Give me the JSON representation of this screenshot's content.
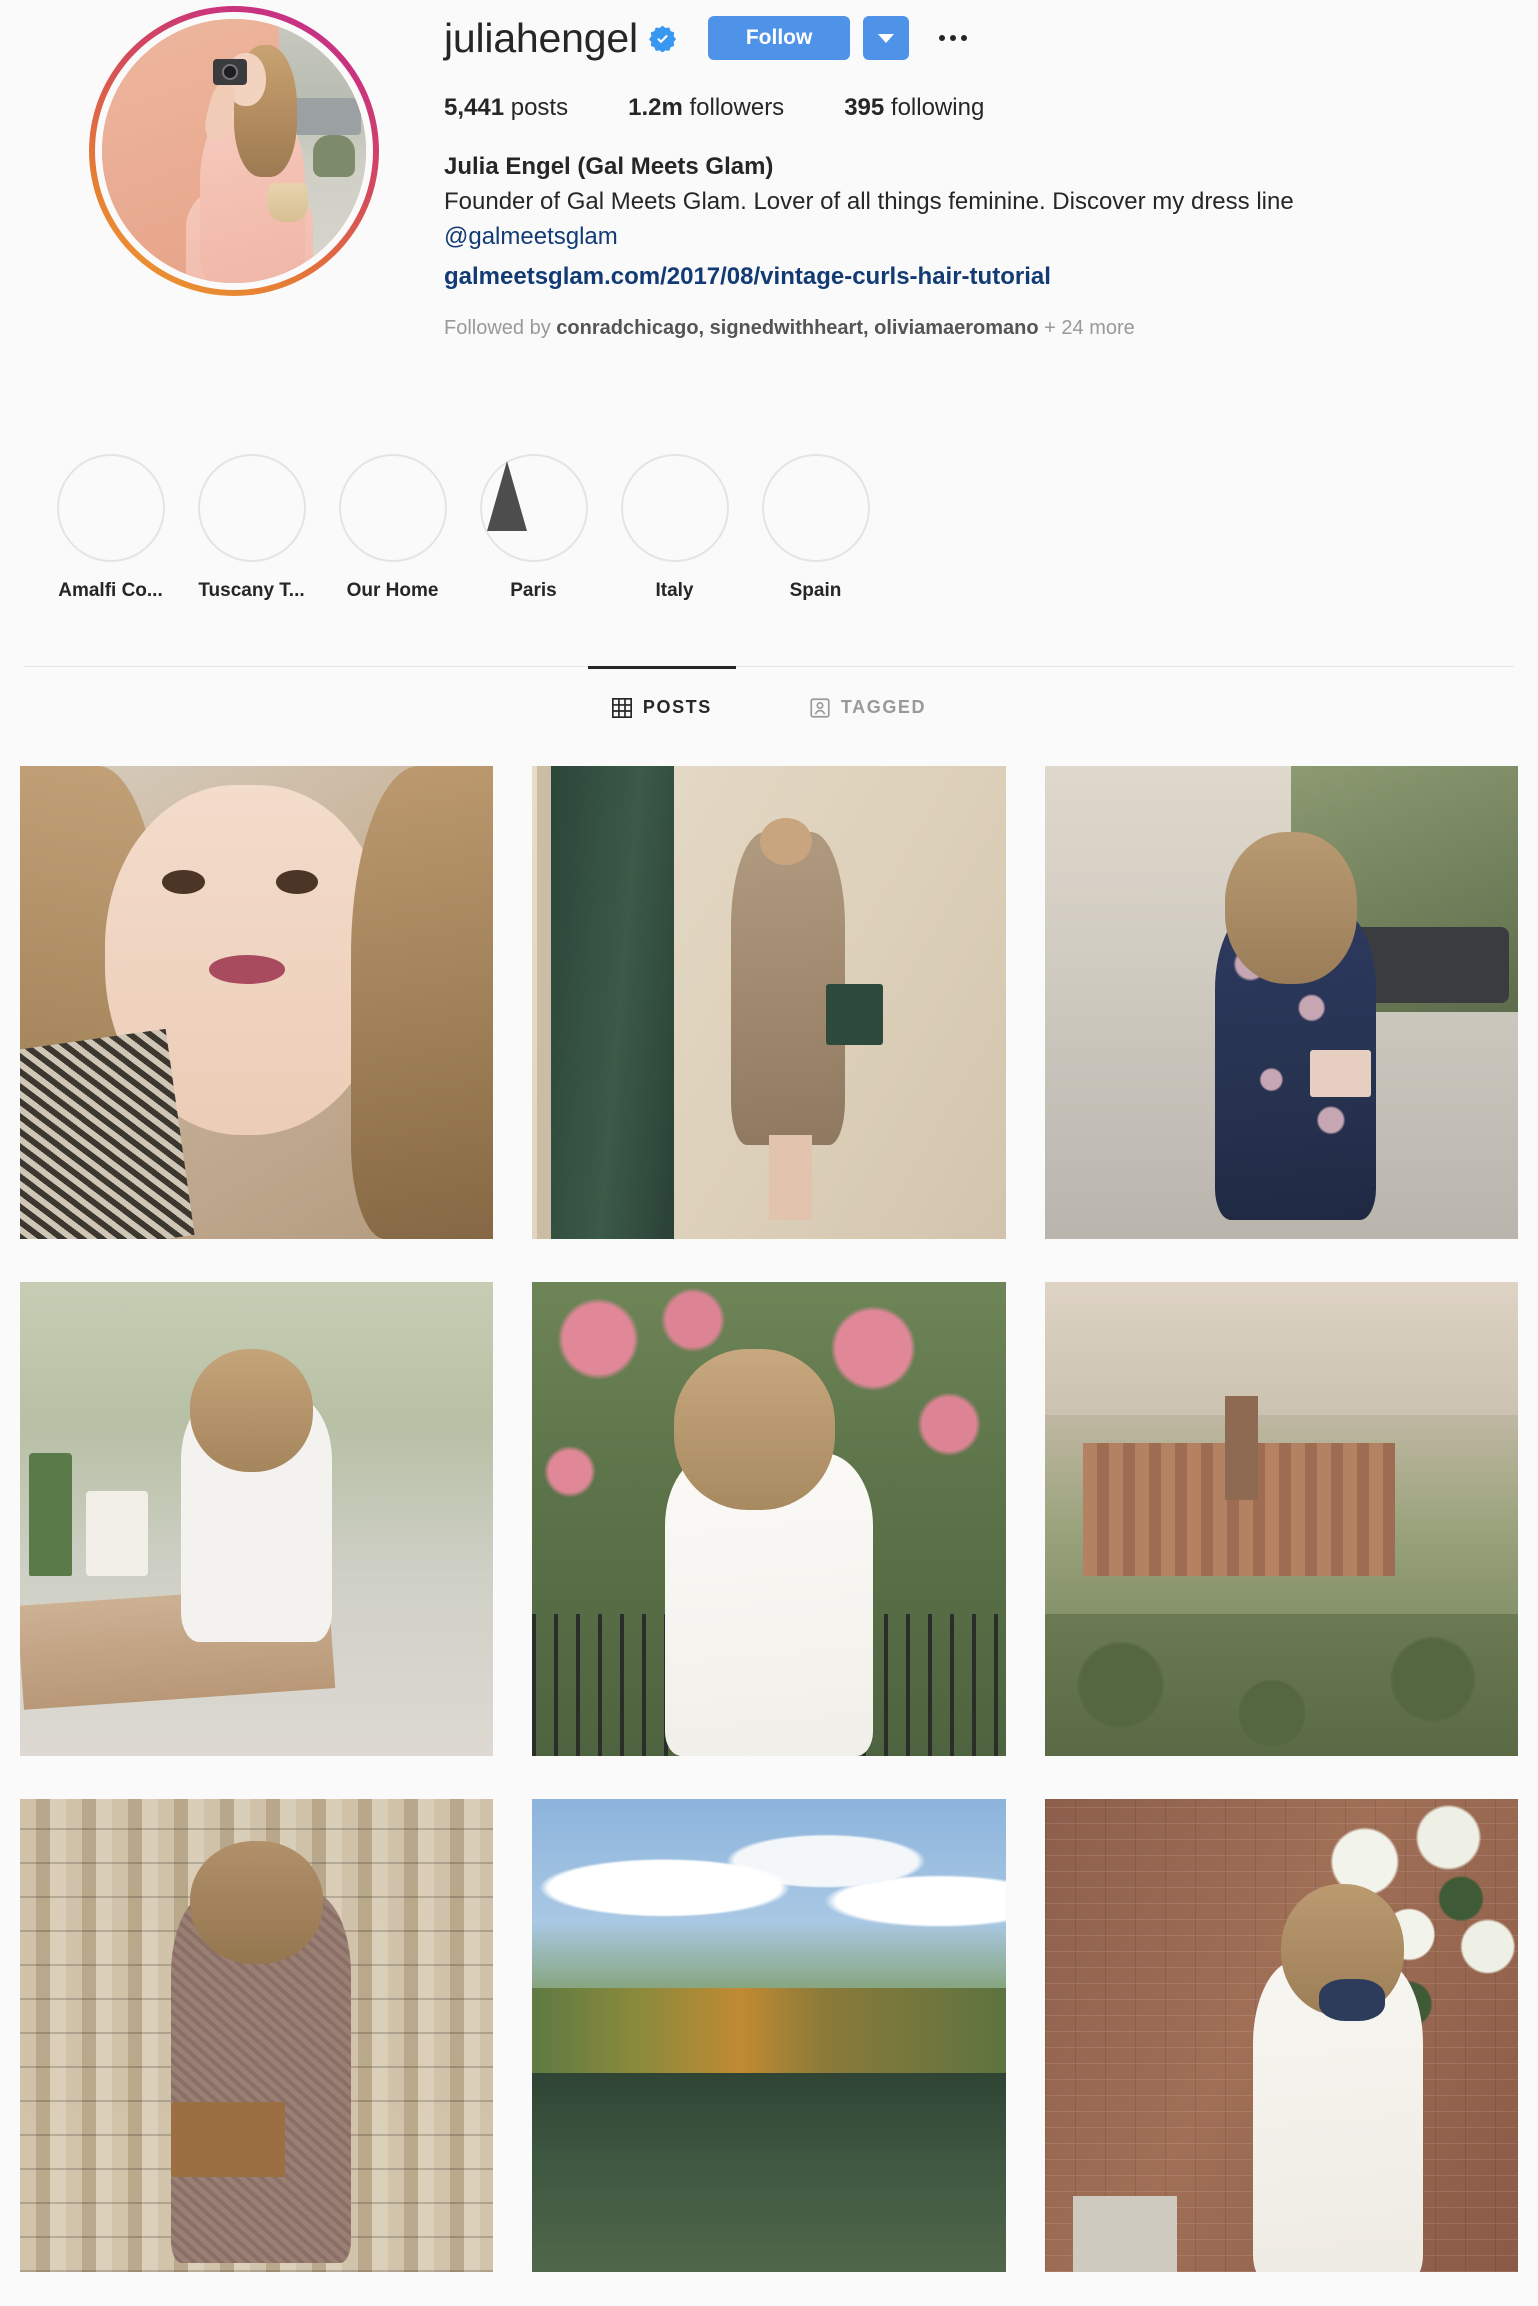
{
  "profile": {
    "username": "juliahengel",
    "verified_badge": "verified-badge-icon",
    "follow_label": "Follow",
    "caret_icon": "chevron-down-icon",
    "more_icon": "more-options-icon",
    "stats": [
      {
        "value": "5,441",
        "label": "posts"
      },
      {
        "value": "1.2m",
        "label": "followers"
      },
      {
        "value": "395",
        "label": "following"
      }
    ],
    "full_name": "Julia Engel (Gal Meets Glam)",
    "bio_text": "Founder of Gal Meets Glam. Lover of all things feminine. Discover my dress line",
    "bio_handle": "@galmeetsglam",
    "website": "galmeetsglam.com/2017/08/vintage-curls-hair-tutorial",
    "followed_by": {
      "prefix": "Followed by ",
      "names": "conradchicago, signedwithheart, oliviamaeromano",
      "suffix": " + 24 more"
    }
  },
  "highlights": [
    {
      "label": "Amalfi Co...",
      "art": "hl-amalfi"
    },
    {
      "label": "Tuscany T...",
      "art": "hl-tuscany"
    },
    {
      "label": "Our Home",
      "art": "hl-home"
    },
    {
      "label": "Paris",
      "art": "hl-paris"
    },
    {
      "label": "Italy",
      "art": "hl-italy"
    },
    {
      "label": "Spain",
      "art": "hl-spain"
    }
  ],
  "tabs": [
    {
      "label": "POSTS",
      "icon": "grid-icon",
      "active": true
    },
    {
      "label": "TAGGED",
      "icon": "person-tag-icon",
      "active": false
    }
  ],
  "grid": [
    {
      "alt": "close-up portrait with houndstooth coat"
    },
    {
      "alt": "woman in brown dress by green door"
    },
    {
      "alt": "woman in navy floral dress on street"
    },
    {
      "alt": "woman in white seated at table"
    },
    {
      "alt": "woman in white dress by flowering bush"
    },
    {
      "alt": "tuscan hilltop town landscape"
    },
    {
      "alt": "woman in plaid dress at book market"
    },
    {
      "alt": "autumn lake and forest reflection"
    },
    {
      "alt": "woman in white dress by hydrangeas"
    }
  ],
  "colors": {
    "accent_blue": "#4f93e8",
    "link_navy": "#123a75",
    "text_primary": "#262626",
    "text_muted": "#999999",
    "page_background": "#fafafa"
  }
}
